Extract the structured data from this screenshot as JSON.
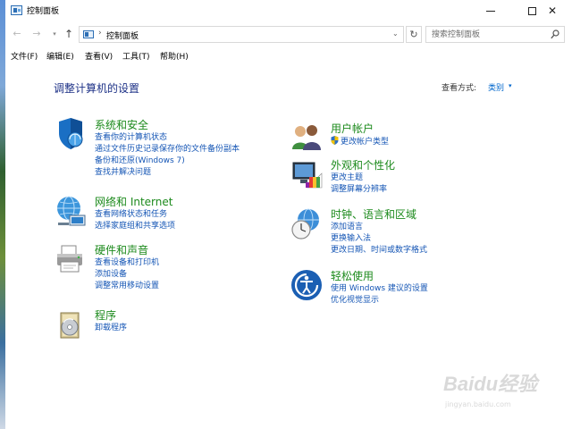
{
  "window": {
    "title": "控制面板",
    "minimize_label": "minimize",
    "maximize_label": "maximize",
    "close_glyph": "✕"
  },
  "nav": {
    "back_glyph": "←",
    "forward_glyph": "→",
    "recent_glyph": "▾",
    "up_glyph": "↑",
    "breadcrumb_sep": "›",
    "address": "控制面板",
    "address_drop_glyph": "⌄",
    "refresh_glyph": "↻",
    "search_placeholder": "搜索控制面板"
  },
  "menu": {
    "items": [
      "文件(F)",
      "编辑(E)",
      "查看(V)",
      "工具(T)",
      "帮助(H)"
    ]
  },
  "content": {
    "title": "调整计算机的设置",
    "view_by_label": "查看方式:",
    "view_by_value": "类别",
    "view_by_caret": "▾"
  },
  "categories": {
    "system_security": {
      "title": "系统和安全",
      "links": [
        "查看你的计算机状态",
        "通过文件历史记录保存你的文件备份副本",
        "备份和还原(Windows 7)",
        "查找并解决问题"
      ]
    },
    "network": {
      "title": "网络和 Internet",
      "links": [
        "查看网络状态和任务",
        "选择家庭组和共享选项"
      ]
    },
    "hardware": {
      "title": "硬件和声音",
      "links": [
        "查看设备和打印机",
        "添加设备",
        "调整常用移动设置"
      ]
    },
    "programs": {
      "title": "程序",
      "links": [
        "卸载程序"
      ]
    },
    "user_accounts": {
      "title": "用户帐户",
      "links": [
        "更改帐户类型"
      ]
    },
    "appearance": {
      "title": "外观和个性化",
      "links": [
        "更改主题",
        "调整屏幕分辨率"
      ]
    },
    "clock_region": {
      "title": "时钟、语言和区域",
      "links": [
        "添加语言",
        "更换输入法",
        "更改日期、时间或数字格式"
      ]
    },
    "ease_access": {
      "title": "轻松使用",
      "links": [
        "使用 Windows 建议的设置",
        "优化视觉显示"
      ]
    }
  },
  "watermark": {
    "logo": "Baidu经验",
    "sub": "jingyan.baidu.com"
  },
  "colors": {
    "category_title": "#1c8a1c",
    "link": "#1556b5",
    "page_title": "#1e3287"
  }
}
